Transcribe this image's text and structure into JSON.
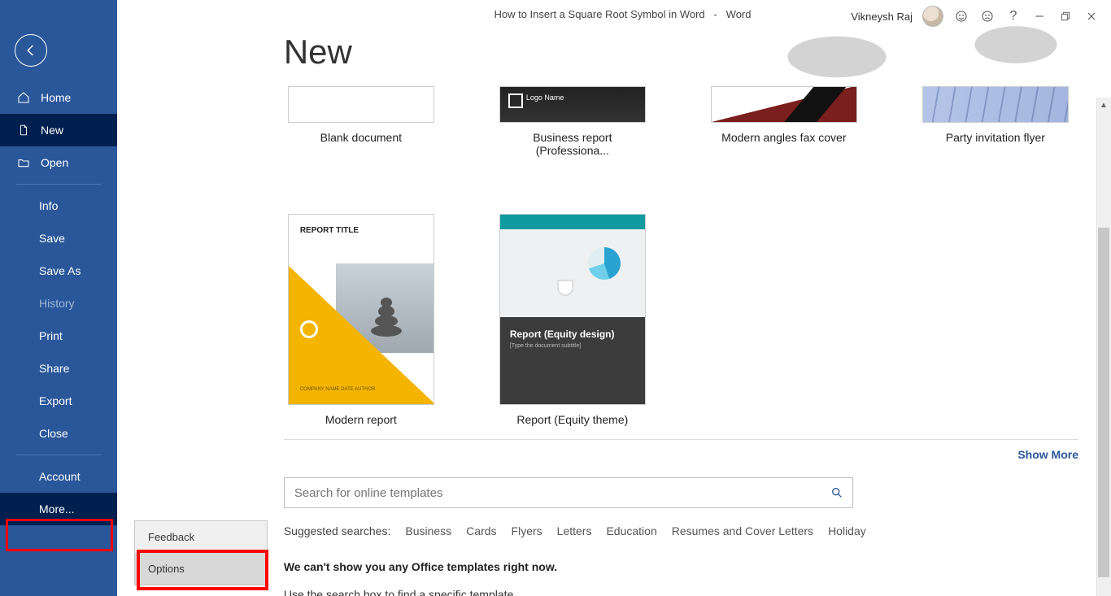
{
  "titlebar": {
    "document_title": "How to Insert a Square Root Symbol in Word",
    "separator": "-",
    "app_name": "Word",
    "user_name": "Vikneysh Raj"
  },
  "sidebar": {
    "home": "Home",
    "new": "New",
    "open": "Open",
    "info": "Info",
    "save": "Save",
    "save_as": "Save As",
    "history": "History",
    "print": "Print",
    "share": "Share",
    "export": "Export",
    "close": "Close",
    "account": "Account",
    "more": "More..."
  },
  "more_menu": {
    "feedback": "Feedback",
    "options": "Options"
  },
  "page": {
    "heading": "New",
    "show_more": "Show More",
    "search_placeholder": "Search for online templates",
    "suggested_label": "Suggested searches:",
    "cant_show_msg": "We can't show you any Office templates right now.",
    "use_search_msg": "Use the search box to find a specific template."
  },
  "templates": {
    "row1": [
      {
        "label": "Blank document"
      },
      {
        "label": "Business report (Professiona..."
      },
      {
        "label": "Modern angles fax cover"
      },
      {
        "label": "Party invitation flyer"
      }
    ],
    "row2": [
      {
        "label": "Modern report",
        "thumb_title": "REPORT TITLE",
        "thumb_sub": "COMPANY NAME\nDATE\nAUTHOR"
      },
      {
        "label": "Report (Equity theme)",
        "thumb_title": "Report (Equity design)",
        "thumb_sub": "[Type the document subtitle]"
      }
    ]
  },
  "suggested": [
    "Business",
    "Cards",
    "Flyers",
    "Letters",
    "Education",
    "Resumes and Cover Letters",
    "Holiday"
  ]
}
